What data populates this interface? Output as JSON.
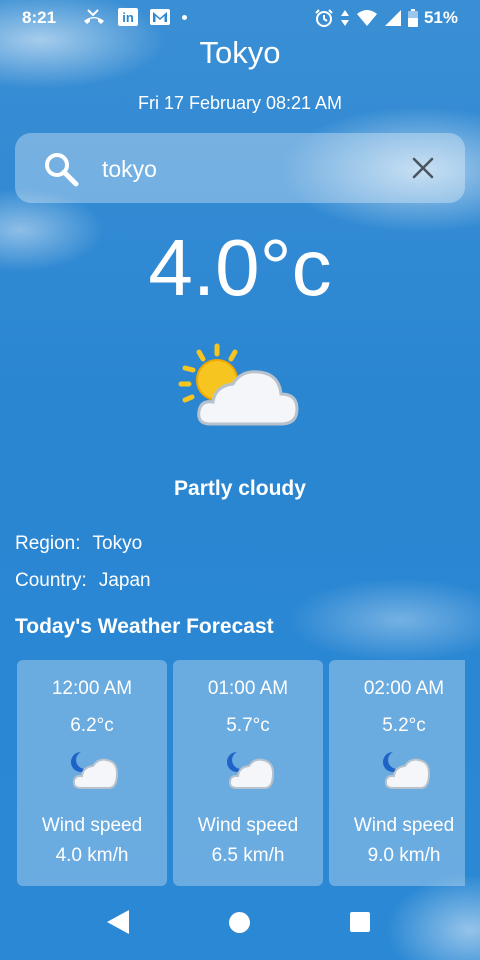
{
  "status_bar": {
    "time": "8:21",
    "linkedin_text": "in",
    "battery": "51%",
    "icons_left": [
      "missed-call-icon",
      "linkedin-icon",
      "gmail-icon",
      "notification-dot-icon"
    ],
    "icons_right": [
      "alarm-icon",
      "data-icon",
      "wifi-icon",
      "signal-icon",
      "battery-icon"
    ]
  },
  "header": {
    "city": "Tokyo",
    "datetime": "Fri 17 February 08:21 AM"
  },
  "search": {
    "value": "tokyo"
  },
  "current": {
    "temperature": "4.0°c",
    "condition": "Partly cloudy",
    "icon": "partly-cloudy-day-icon"
  },
  "location": {
    "region_label": "Region:",
    "region_value": "Tokyo",
    "country_label": "Country:",
    "country_value": "Japan"
  },
  "forecast": {
    "title": "Today's Weather Forecast",
    "items": [
      {
        "time": "12:00 AM",
        "temp": "6.2°c",
        "wind_label": "Wind speed",
        "wind": "4.0 km/h",
        "icon": "partly-cloudy-night-icon"
      },
      {
        "time": "01:00 AM",
        "temp": "5.7°c",
        "wind_label": "Wind speed",
        "wind": "6.5 km/h",
        "icon": "partly-cloudy-night-icon"
      },
      {
        "time": "02:00 AM",
        "temp": "5.2°c",
        "wind_label": "Wind speed",
        "wind": "9.0 km/h",
        "icon": "partly-cloudy-night-icon"
      }
    ]
  },
  "colors": {
    "sky": "#2b86d2",
    "sun": "#f7c520",
    "moon": "#1e63c8",
    "cloud": "#f4f6f9"
  }
}
